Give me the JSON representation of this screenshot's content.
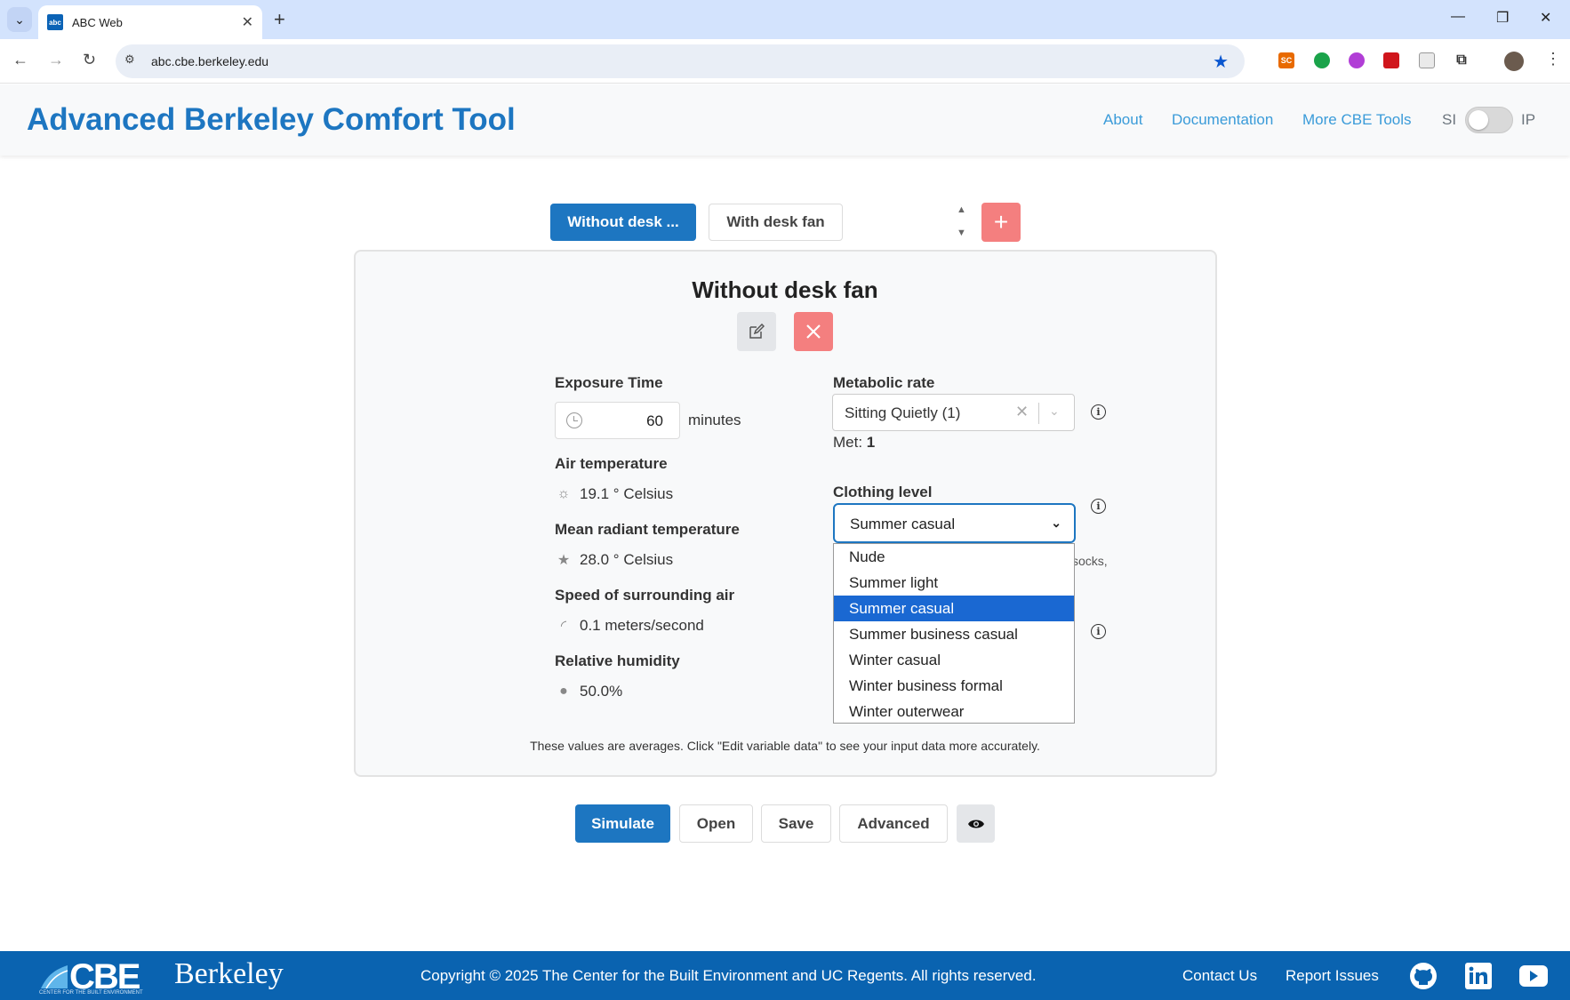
{
  "browser": {
    "tab_title": "ABC Web",
    "favicon_text": "abc",
    "url": "abc.cbe.berkeley.edu"
  },
  "header": {
    "title": "Advanced Berkeley Comfort Tool",
    "nav": [
      "About",
      "Documentation",
      "More CBE Tools"
    ],
    "unit_si": "SI",
    "unit_ip": "IP"
  },
  "cases": {
    "tabs": [
      "Without desk ...",
      "With desk fan"
    ],
    "add_label": "+"
  },
  "panel": {
    "title": "Without desk fan",
    "exposure_label": "Exposure Time",
    "exposure_value": "60",
    "exposure_unit": "minutes",
    "air_temp_label": "Air temperature",
    "air_temp_value": "19.1 ° Celsius",
    "mrt_label": "Mean radiant temperature",
    "mrt_value": "28.0 ° Celsius",
    "air_speed_label": "Speed of surrounding air",
    "air_speed_value": "0.1 meters/second",
    "rh_label": "Relative humidity",
    "rh_value": "50.0%",
    "metabolic_label": "Metabolic rate",
    "metabolic_value": "Sitting Quietly (1)",
    "met_prefix": "Met:",
    "met_value": "1",
    "clothing_label": "Clothing level",
    "clothing_value": "Summer casual",
    "clothing_options": [
      "Nude",
      "Summer light",
      "Summer casual",
      "Summer business casual",
      "Winter casual",
      "Winter business formal",
      "Winter outerwear"
    ],
    "clothing_selected_index": 2,
    "behind_text": "socks,",
    "note": "These values are averages. Click \"Edit variable data\" to see your input data more accurately."
  },
  "actions": {
    "simulate": "Simulate",
    "open": "Open",
    "save": "Save",
    "advanced": "Advanced"
  },
  "footer": {
    "cbe": "CBE",
    "cbe_sub": "CENTER FOR THE BUILT ENVIRONMENT",
    "berkeley": "Berkeley",
    "copyright": "Copyright © 2025 The Center for the Built Environment and UC Regents. All rights reserved.",
    "contact": "Contact Us",
    "report": "Report Issues"
  },
  "colors": {
    "brand": "#1d76c1",
    "danger": "#f47f7f",
    "footer": "#0a63b0"
  }
}
